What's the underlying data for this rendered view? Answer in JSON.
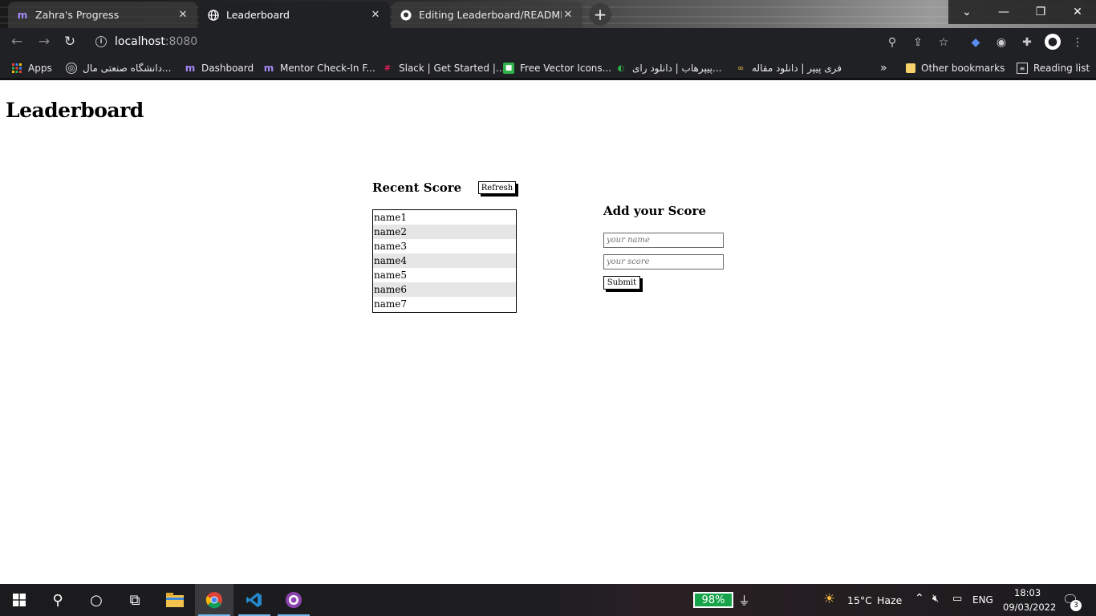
{
  "browser": {
    "tabs": [
      {
        "title": "Zahra's Progress",
        "icon": "m-logo-icon",
        "active": false
      },
      {
        "title": "Leaderboard",
        "icon": "globe-icon",
        "active": true
      },
      {
        "title": "Editing Leaderboard/README.m",
        "icon": "github-icon",
        "active": false
      }
    ],
    "new_tab": "+",
    "url_host": "localhost",
    "url_port": ":8080",
    "bookmarks": [
      {
        "label": "Apps",
        "icon": "apps-grid-icon"
      },
      {
        "label": "دانشگاه صنعتی مال...",
        "icon": "university-icon"
      },
      {
        "label": "Dashboard",
        "icon": "m-logo-icon"
      },
      {
        "label": "Mentor Check-In F...",
        "icon": "m-logo-icon"
      },
      {
        "label": "Slack | Get Started |...",
        "icon": "slack-icon"
      },
      {
        "label": "Free Vector Icons...",
        "icon": "flaticon-icon"
      },
      {
        "label": "پیپرهاب | دانلود رای...",
        "icon": "paperhub-icon"
      },
      {
        "label": "فری پیپر | دانلود مقاله",
        "icon": "glasses-icon"
      }
    ],
    "bookmarks_more": "»",
    "other_bookmarks": "Other bookmarks",
    "reading_list": "Reading list"
  },
  "page": {
    "title": "Leaderboard",
    "recent_title": "Recent Score",
    "refresh_label": "Refresh",
    "scores": [
      "name1",
      "name2",
      "name3",
      "name4",
      "name5",
      "name6",
      "name7"
    ],
    "add_title": "Add your Score",
    "name_placeholder": "your name",
    "score_placeholder": "your score",
    "submit_label": "Submit"
  },
  "taskbar": {
    "battery": "98%",
    "weather_temp": "15°C",
    "weather_desc": "Haze",
    "language": "ENG",
    "time": "18:03",
    "date": "09/03/2022",
    "notifications": "3"
  }
}
